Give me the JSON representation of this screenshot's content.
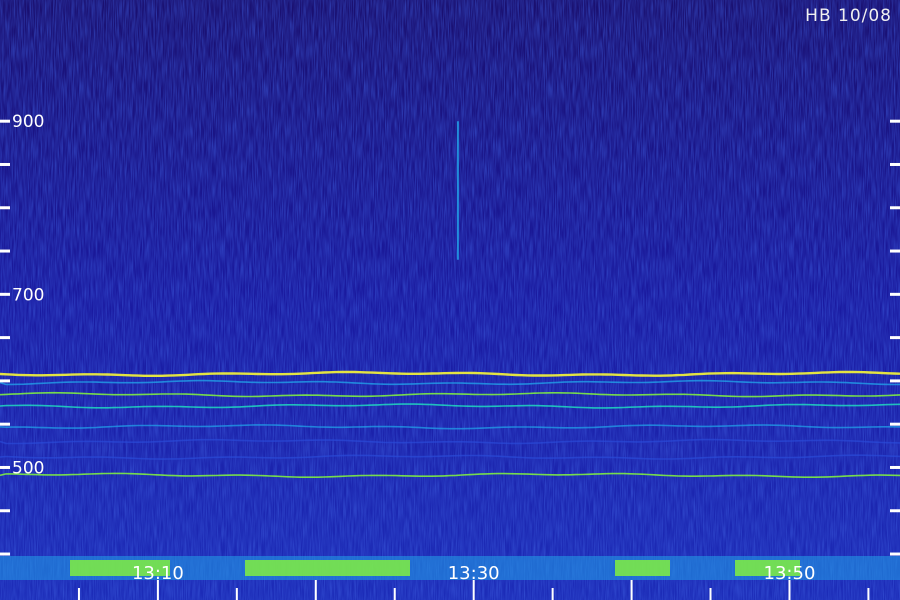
{
  "chart_data": {
    "type": "heatmap",
    "title": "HB 10/08",
    "xlabel": "",
    "ylabel": "",
    "x_tick_labels": [
      "13:10",
      "13:30",
      "13:50"
    ],
    "x_range": [
      "13:00",
      "13:57"
    ],
    "y_ticks": [
      400,
      450,
      500,
      550,
      600,
      650,
      700,
      750,
      800,
      850,
      900
    ],
    "y_tick_labels": [
      "500",
      "700",
      "900"
    ],
    "ylim": [
      370,
      1040
    ],
    "grid": false,
    "colormap": [
      "#0a0a55",
      "#1a1aa0",
      "#2a4ad8",
      "#22a0e8",
      "#20e0c0",
      "#80f040",
      "#e8e840"
    ],
    "bands": [
      {
        "freq": 608,
        "intensity": 0.95
      },
      {
        "freq": 598,
        "intensity": 0.55
      },
      {
        "freq": 584,
        "intensity": 0.75
      },
      {
        "freq": 571,
        "intensity": 0.6
      },
      {
        "freq": 547,
        "intensity": 0.45
      },
      {
        "freq": 491,
        "intensity": 0.75
      },
      {
        "freq": 512,
        "intensity": 0.35
      },
      {
        "freq": 530,
        "intensity": 0.3
      }
    ],
    "impulse": {
      "time": "13:29",
      "freq_range": [
        740,
        900
      ]
    }
  }
}
